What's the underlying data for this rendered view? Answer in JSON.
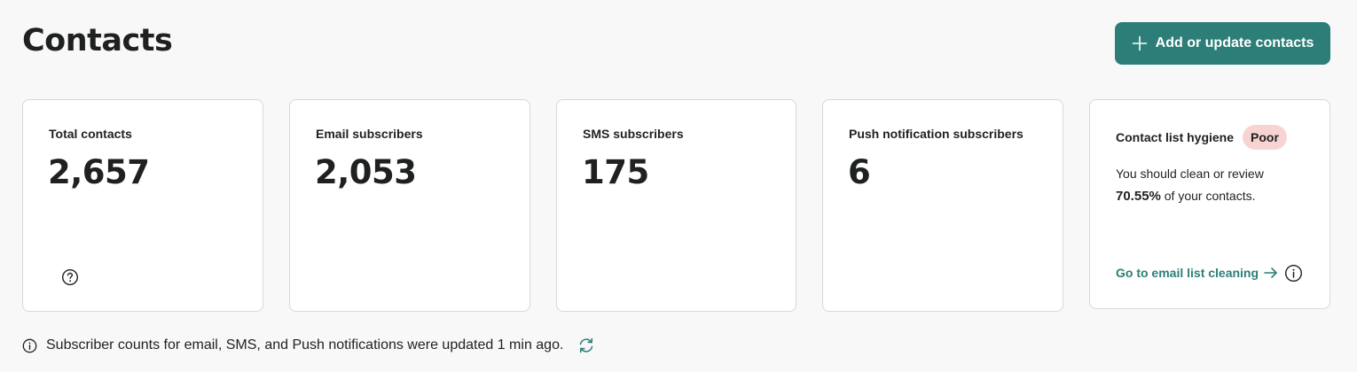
{
  "header": {
    "title": "Contacts",
    "add_button_label": "Add or update contacts"
  },
  "cards": [
    {
      "label": "Total contacts",
      "value": "2,657"
    },
    {
      "label": "Email subscribers",
      "value": "2,053"
    },
    {
      "label": "SMS subscribers",
      "value": "175"
    },
    {
      "label": "Push notification subscribers",
      "value": "6"
    }
  ],
  "hygiene": {
    "title": "Contact list hygiene",
    "badge": "Poor",
    "text_before": "You should clean or review",
    "percentage": "70.55%",
    "text_after": "of your contacts.",
    "link_label": "Go to email list cleaning"
  },
  "footer": {
    "note": "Subscriber counts for email, SMS, and Push notifications were updated 1 min ago."
  },
  "colors": {
    "accent": "#2d7e78",
    "badge_poor_bg": "#f7d4d2",
    "background": "#f7f8f7",
    "card_border": "#d6d9d8"
  },
  "icons": {
    "add": "plus-icon",
    "help": "question-circle-icon",
    "link": "arrow-right-icon",
    "info": "info-circle-icon",
    "refresh": "refresh-icon"
  }
}
